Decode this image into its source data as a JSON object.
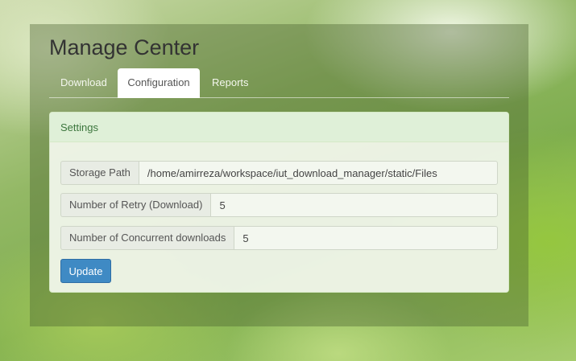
{
  "header": {
    "title": "Manage Center"
  },
  "tabs": [
    {
      "label": "Download"
    },
    {
      "label": "Configuration",
      "active": true
    },
    {
      "label": "Reports"
    }
  ],
  "settings": {
    "heading": "Settings",
    "storage_path_label": "Storage Path",
    "storage_path_value": "/home/amirreza/workspace/iut_download_manager/static/Files",
    "retry_label": "Number of Retry (Download)",
    "retry_value": "5",
    "concurrent_label": "Number of Concurrent downloads",
    "concurrent_value": "5",
    "update_label": "Update"
  },
  "colors": {
    "panel_heading_bg": "#dff0d8",
    "panel_heading_text": "#3c763d",
    "primary_button": "#3f8ac4"
  }
}
